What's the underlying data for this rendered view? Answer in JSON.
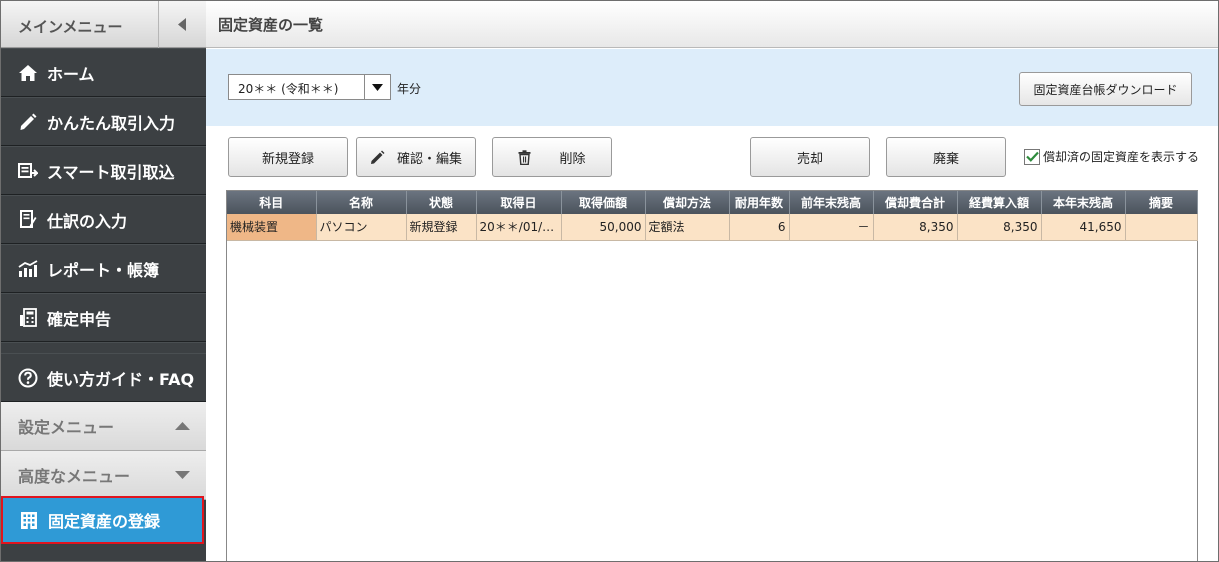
{
  "sidebar": {
    "header": "メインメニュー",
    "collapse_icon": "chevron-left-icon",
    "items": [
      {
        "label": "ホーム",
        "icon": "home-icon"
      },
      {
        "label": "かんたん取引入力",
        "icon": "pencil-icon"
      },
      {
        "label": "スマート取引取込",
        "icon": "import-icon"
      },
      {
        "label": "仕訳の入力",
        "icon": "journal-icon"
      },
      {
        "label": "レポート・帳簿",
        "icon": "chart-icon"
      },
      {
        "label": "確定申告",
        "icon": "calculator-icon"
      },
      {
        "label": "使い方ガイド・FAQ",
        "icon": "help-icon"
      }
    ],
    "settings_menu": "設定メニュー",
    "advanced_menu": "高度なメニュー",
    "active_item": "固定資産の登録"
  },
  "page": {
    "title": "固定資産の一覧"
  },
  "filter": {
    "year_value": "20＊＊ (令和＊＊)",
    "year_suffix": "年分",
    "download_label": "固定資産台帳ダウンロード"
  },
  "toolbar": {
    "new_label": "新規登録",
    "edit_label": "確認・編集",
    "delete_label": "削除",
    "sell_label": "売却",
    "dispose_label": "廃棄",
    "show_depreciated_label": "償却済の固定資産を表示する",
    "show_depreciated_checked": true
  },
  "table": {
    "headers": [
      "科目",
      "名称",
      "状態",
      "取得日",
      "取得価額",
      "償却方法",
      "耐用年数",
      "前年末残高",
      "償却費合計",
      "経費算入額",
      "本年末残高",
      "摘要"
    ],
    "rows": [
      [
        "機械装置",
        "パソコン",
        "新規登録",
        "20＊＊/01/…",
        "50,000",
        "定額法",
        "6",
        "－",
        "8,350",
        "8,350",
        "41,650",
        ""
      ]
    ]
  },
  "colors": {
    "sidebar_bg": "#3c4043",
    "active_bg": "#2f9ad6",
    "active_border": "#e0141e",
    "filter_bg": "#ddedfa",
    "row_bg": "#fbe3c6",
    "row_first_bg": "#efb787",
    "header_bg": "#4b535c"
  }
}
